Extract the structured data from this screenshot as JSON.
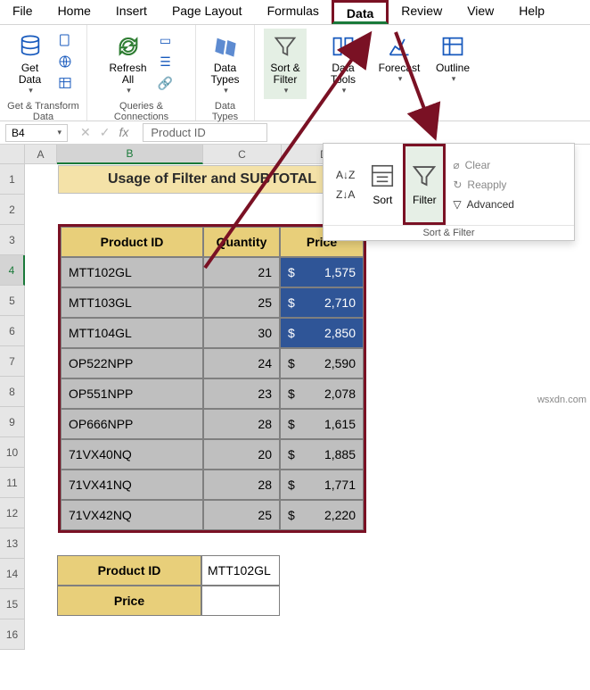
{
  "menu": {
    "file": "File",
    "home": "Home",
    "insert": "Insert",
    "pagelayout": "Page Layout",
    "formulas": "Formulas",
    "data": "Data",
    "review": "Review",
    "view": "View",
    "help": "Help"
  },
  "ribbon": {
    "get_data": "Get\nData",
    "refresh": "Refresh\nAll",
    "data_types": "Data\nTypes",
    "sort_filter": "Sort &\nFilter",
    "data_tools": "Data\nTools",
    "forecast": "Forecast",
    "outline": "Outline",
    "grp_get": "Get & Transform Data",
    "grp_queries": "Queries & Connections",
    "grp_types": "Data Types"
  },
  "dropdown": {
    "sort": "Sort",
    "filter": "Filter",
    "clear": "Clear",
    "reapply": "Reapply",
    "advanced": "Advanced",
    "grp": "Sort & Filter"
  },
  "fbar": {
    "name": "B4",
    "value": "Product ID"
  },
  "cols": {
    "A": "A",
    "B": "B",
    "C": "C",
    "D": "D"
  },
  "rows": [
    "1",
    "2",
    "3",
    "4",
    "5",
    "6",
    "7",
    "8",
    "9",
    "10",
    "11",
    "12",
    "13",
    "14",
    "15",
    "16"
  ],
  "banner": "Usage of Filter and SUBTOTAL",
  "headers": {
    "id": "Product ID",
    "qty": "Quantity",
    "price": "Price"
  },
  "data": [
    {
      "id": "MTT102GL",
      "qty": "21",
      "p": "1,575",
      "hl": true
    },
    {
      "id": "MTT103GL",
      "qty": "25",
      "p": "2,710",
      "hl": true
    },
    {
      "id": "MTT104GL",
      "qty": "30",
      "p": "2,850",
      "hl": true
    },
    {
      "id": "OP522NPP",
      "qty": "24",
      "p": "2,590",
      "hl": false
    },
    {
      "id": "OP551NPP",
      "qty": "23",
      "p": "2,078",
      "hl": false
    },
    {
      "id": "OP666NPP",
      "qty": "28",
      "p": "1,615",
      "hl": false
    },
    {
      "id": "71VX40NQ",
      "qty": "20",
      "p": "1,885",
      "hl": false
    },
    {
      "id": "71VX41NQ",
      "qty": "28",
      "p": "1,771",
      "hl": false
    },
    {
      "id": "71VX42NQ",
      "qty": "25",
      "p": "2,220",
      "hl": false
    }
  ],
  "chart_data": {
    "type": "table",
    "columns": [
      "Product ID",
      "Quantity",
      "Price"
    ],
    "rows": [
      [
        "MTT102GL",
        21,
        1575
      ],
      [
        "MTT103GL",
        25,
        2710
      ],
      [
        "MTT104GL",
        30,
        2850
      ],
      [
        "OP522NPP",
        24,
        2590
      ],
      [
        "OP551NPP",
        23,
        2078
      ],
      [
        "OP666NPP",
        28,
        1615
      ],
      [
        "71VX40NQ",
        20,
        1885
      ],
      [
        "71VX41NQ",
        28,
        1771
      ],
      [
        "71VX42NQ",
        25,
        2220
      ]
    ]
  },
  "currency": "$",
  "lookup": {
    "id_label": "Product ID",
    "price_label": "Price",
    "id_val": "MTT102GL",
    "price_val": ""
  },
  "watermark": "wsxdn.com"
}
